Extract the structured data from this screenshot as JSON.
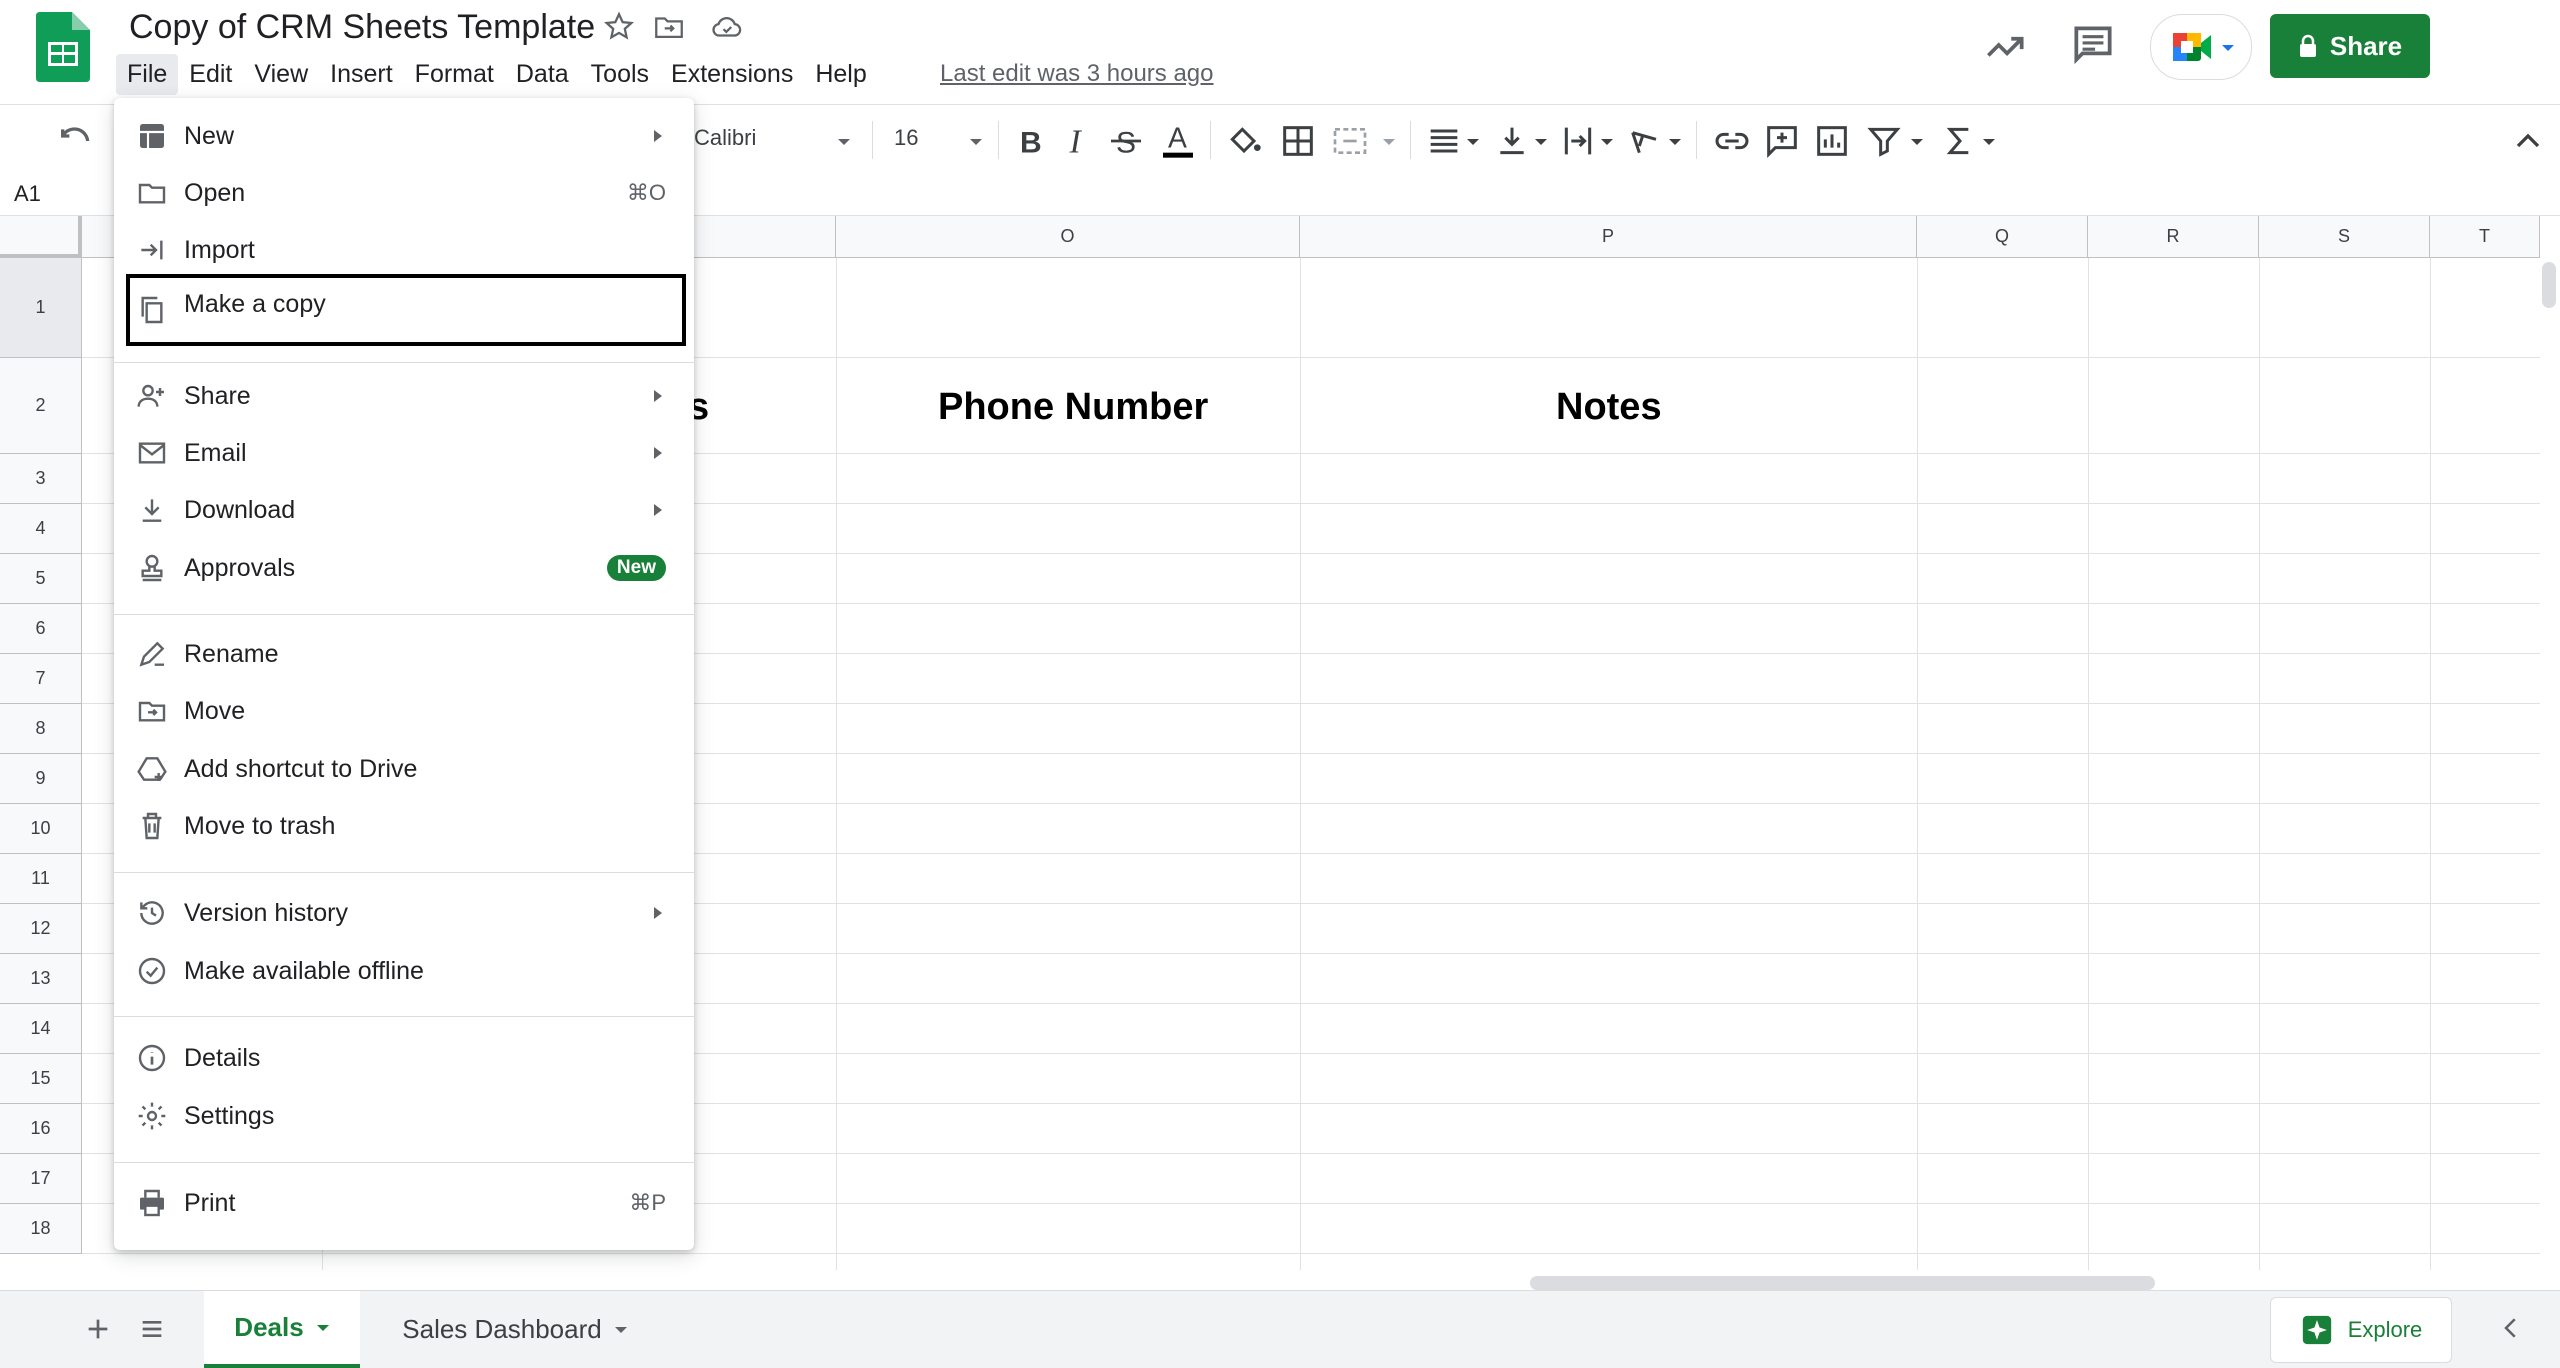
{
  "header": {
    "title": "Copy of CRM Sheets Template",
    "menus": [
      "File",
      "Edit",
      "View",
      "Insert",
      "Format",
      "Data",
      "Tools",
      "Extensions",
      "Help"
    ],
    "last_edit": "Last edit was 3 hours ago",
    "share_label": "Share"
  },
  "toolbar": {
    "font": "Calibri",
    "font_size": "16"
  },
  "formula_bar": {
    "cell_ref": "A1"
  },
  "grid": {
    "columns": [
      "O",
      "P",
      "Q",
      "R",
      "S",
      "T"
    ],
    "rows": [
      "1",
      "2",
      "3",
      "4",
      "5",
      "6",
      "7",
      "8",
      "9",
      "10",
      "11",
      "12",
      "13",
      "14",
      "15",
      "16",
      "17",
      "18"
    ],
    "partial_cell_text": "s",
    "phone_header": "Phone Number",
    "notes_header": "Notes"
  },
  "file_menu": {
    "new": "New",
    "open": "Open",
    "open_shortcut": "⌘O",
    "import": "Import",
    "make_copy": "Make a copy",
    "share": "Share",
    "email": "Email",
    "download": "Download",
    "approvals": "Approvals",
    "approvals_badge": "New",
    "rename": "Rename",
    "move": "Move",
    "add_shortcut": "Add shortcut to Drive",
    "trash": "Move to trash",
    "version_history": "Version history",
    "offline": "Make available offline",
    "details": "Details",
    "settings": "Settings",
    "print": "Print",
    "print_shortcut": "⌘P"
  },
  "sheets": {
    "tabs": [
      "Deals",
      "Sales Dashboard"
    ],
    "active": "Deals",
    "explore_label": "Explore"
  },
  "colors": {
    "brand_green": "#188038",
    "menu_highlight": "#e8eaed"
  }
}
